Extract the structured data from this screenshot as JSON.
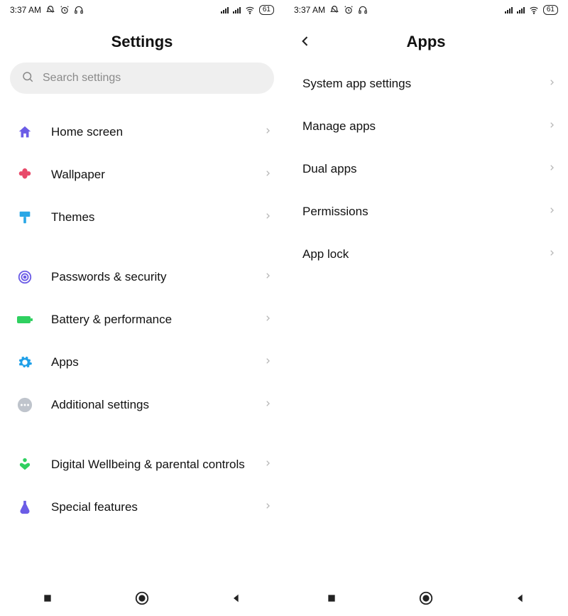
{
  "status": {
    "time": "3:37 AM",
    "battery": "61"
  },
  "left": {
    "title": "Settings",
    "searchPlaceholder": "Search settings",
    "groups": [
      [
        {
          "id": "home-screen",
          "label": "Home screen",
          "color": "#6b5ce6",
          "icon": "home"
        },
        {
          "id": "wallpaper",
          "label": "Wallpaper",
          "color": "#e84a6a",
          "icon": "flower"
        },
        {
          "id": "themes",
          "label": "Themes",
          "color": "#2aa7e6",
          "icon": "brush"
        }
      ],
      [
        {
          "id": "passwords-security",
          "label": "Passwords & security",
          "color": "#6b5ce6",
          "icon": "fingerprint"
        },
        {
          "id": "battery-perf",
          "label": "Battery & performance",
          "color": "#2fd060",
          "icon": "battery"
        },
        {
          "id": "apps",
          "label": "Apps",
          "color": "#1e9fe8",
          "icon": "gear"
        },
        {
          "id": "additional",
          "label": "Additional settings",
          "color": "#bfc4cc",
          "icon": "dots"
        }
      ],
      [
        {
          "id": "digital-wellbeing",
          "label": "Digital Wellbeing & parental controls",
          "color": "#2fd060",
          "icon": "heart"
        },
        {
          "id": "special-features",
          "label": "Special features",
          "color": "#6b5ce6",
          "icon": "flask"
        }
      ]
    ]
  },
  "right": {
    "title": "Apps",
    "items": [
      {
        "id": "system-app-settings",
        "label": "System app settings"
      },
      {
        "id": "manage-apps",
        "label": "Manage apps"
      },
      {
        "id": "dual-apps",
        "label": "Dual apps"
      },
      {
        "id": "permissions",
        "label": "Permissions"
      },
      {
        "id": "app-lock",
        "label": "App lock"
      }
    ]
  }
}
